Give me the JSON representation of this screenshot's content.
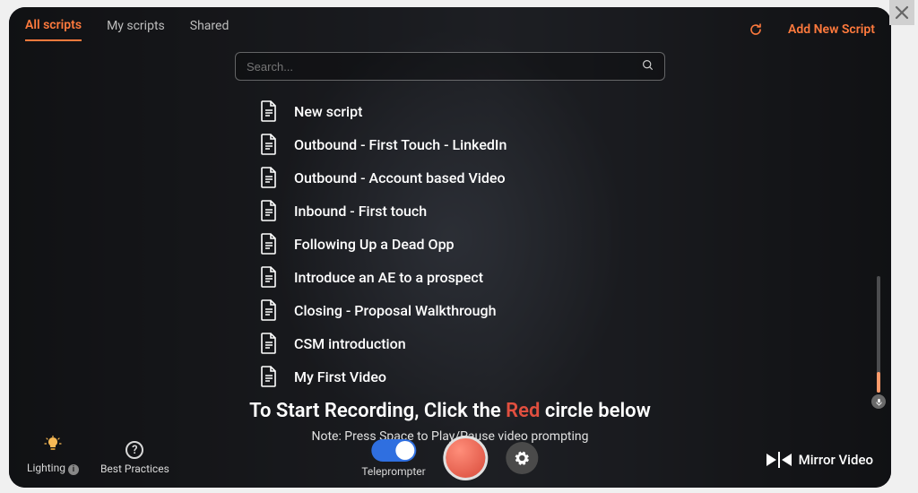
{
  "tabs": {
    "all": "All scripts",
    "my": "My scripts",
    "shared": "Shared"
  },
  "header": {
    "add_new": "Add New Script"
  },
  "search": {
    "placeholder": "Search..."
  },
  "scripts": [
    "New script",
    "Outbound - First Touch - LinkedIn",
    "Outbound - Account based Video",
    "Inbound - First touch",
    "Following Up a Dead Opp",
    "Introduce an AE to a prospect",
    "Closing - Proposal Walkthrough",
    "CSM introduction",
    "My First Video"
  ],
  "instructions": {
    "line1_pre": "To Start Recording, Click the ",
    "line1_red": "Red",
    "line1_post": " circle below",
    "note": "Note: Press Space to Play/Pause video prompting"
  },
  "bottom": {
    "lighting": "Lighting",
    "best_practices": "Best Practices",
    "teleprompter": "Teleprompter",
    "mirror": "Mirror Video"
  }
}
